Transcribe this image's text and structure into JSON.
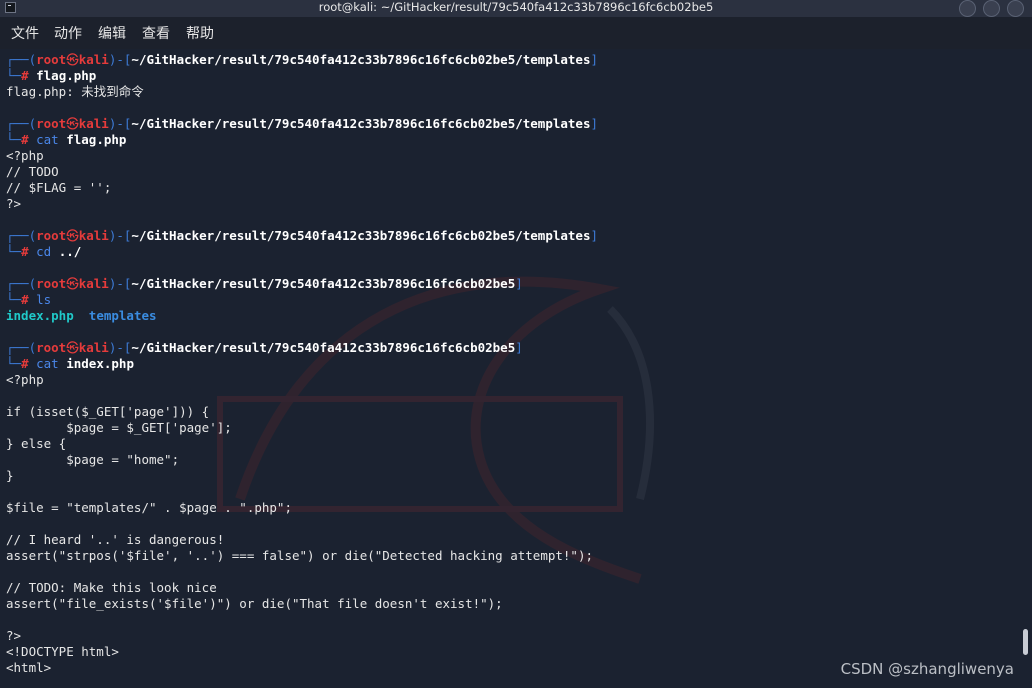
{
  "window": {
    "title": "root@kali: ~/GitHacker/result/79c540fa412c33b7896c16fc6cb02be5"
  },
  "menu": {
    "items": [
      "文件",
      "动作",
      "编辑",
      "查看",
      "帮助"
    ]
  },
  "prompt": {
    "user": "root",
    "host": "kali",
    "skull": "㉿",
    "hash": "#",
    "path_templates": "~/GitHacker/result/79c540fa412c33b7896c16fc6cb02be5/templates",
    "path_root": "~/GitHacker/result/79c540fa412c33b7896c16fc6cb02be5"
  },
  "session": [
    {
      "type": "prompt",
      "path": "templates",
      "cmd": "",
      "arg": "flag.php"
    },
    {
      "type": "out",
      "text": "flag.php: 未找到命令"
    },
    {
      "type": "blank"
    },
    {
      "type": "prompt",
      "path": "templates",
      "cmd": "cat",
      "arg": "flag.php"
    },
    {
      "type": "out",
      "text": "<?php"
    },
    {
      "type": "out",
      "text": "// TODO"
    },
    {
      "type": "out",
      "text": "// $FLAG = '';"
    },
    {
      "type": "out",
      "text": "?>"
    },
    {
      "type": "blank"
    },
    {
      "type": "prompt",
      "path": "templates",
      "cmd": "cd",
      "arg": "../"
    },
    {
      "type": "blank"
    },
    {
      "type": "prompt",
      "path": "root",
      "cmd": "ls",
      "arg": ""
    },
    {
      "type": "ls",
      "file": "index.php",
      "dir": "templates"
    },
    {
      "type": "blank"
    },
    {
      "type": "prompt",
      "path": "root",
      "cmd": "cat",
      "arg": "index.php"
    },
    {
      "type": "out",
      "text": "<?php"
    },
    {
      "type": "blank"
    },
    {
      "type": "out",
      "text": "if (isset($_GET['page'])) {"
    },
    {
      "type": "out",
      "text": "        $page = $_GET['page'];"
    },
    {
      "type": "out",
      "text": "} else {"
    },
    {
      "type": "out",
      "text": "        $page = \"home\";"
    },
    {
      "type": "out",
      "text": "}"
    },
    {
      "type": "blank"
    },
    {
      "type": "out",
      "text": "$file = \"templates/\" . $page . \".php\";"
    },
    {
      "type": "blank"
    },
    {
      "type": "out",
      "text": "// I heard '..' is dangerous!"
    },
    {
      "type": "out",
      "text": "assert(\"strpos('$file', '..') === false\") or die(\"Detected hacking attempt!\");"
    },
    {
      "type": "blank"
    },
    {
      "type": "out",
      "text": "// TODO: Make this look nice"
    },
    {
      "type": "out",
      "text": "assert(\"file_exists('$file')\") or die(\"That file doesn't exist!\");"
    },
    {
      "type": "blank"
    },
    {
      "type": "out",
      "text": "?>"
    },
    {
      "type": "out",
      "text": "<!DOCTYPE html>"
    },
    {
      "type": "out",
      "text": "<html>"
    }
  ],
  "watermark": {
    "csdn": "CSDN @szhangliwenya"
  },
  "colors": {
    "background": "#1b2230",
    "prompt_red": "#e53b3b",
    "frame_blue": "#3d7bd6",
    "cmd_blue": "#4a86e8",
    "ls_file_cyan": "#20c8c8",
    "ls_dir_blue": "#3a8ce0"
  }
}
